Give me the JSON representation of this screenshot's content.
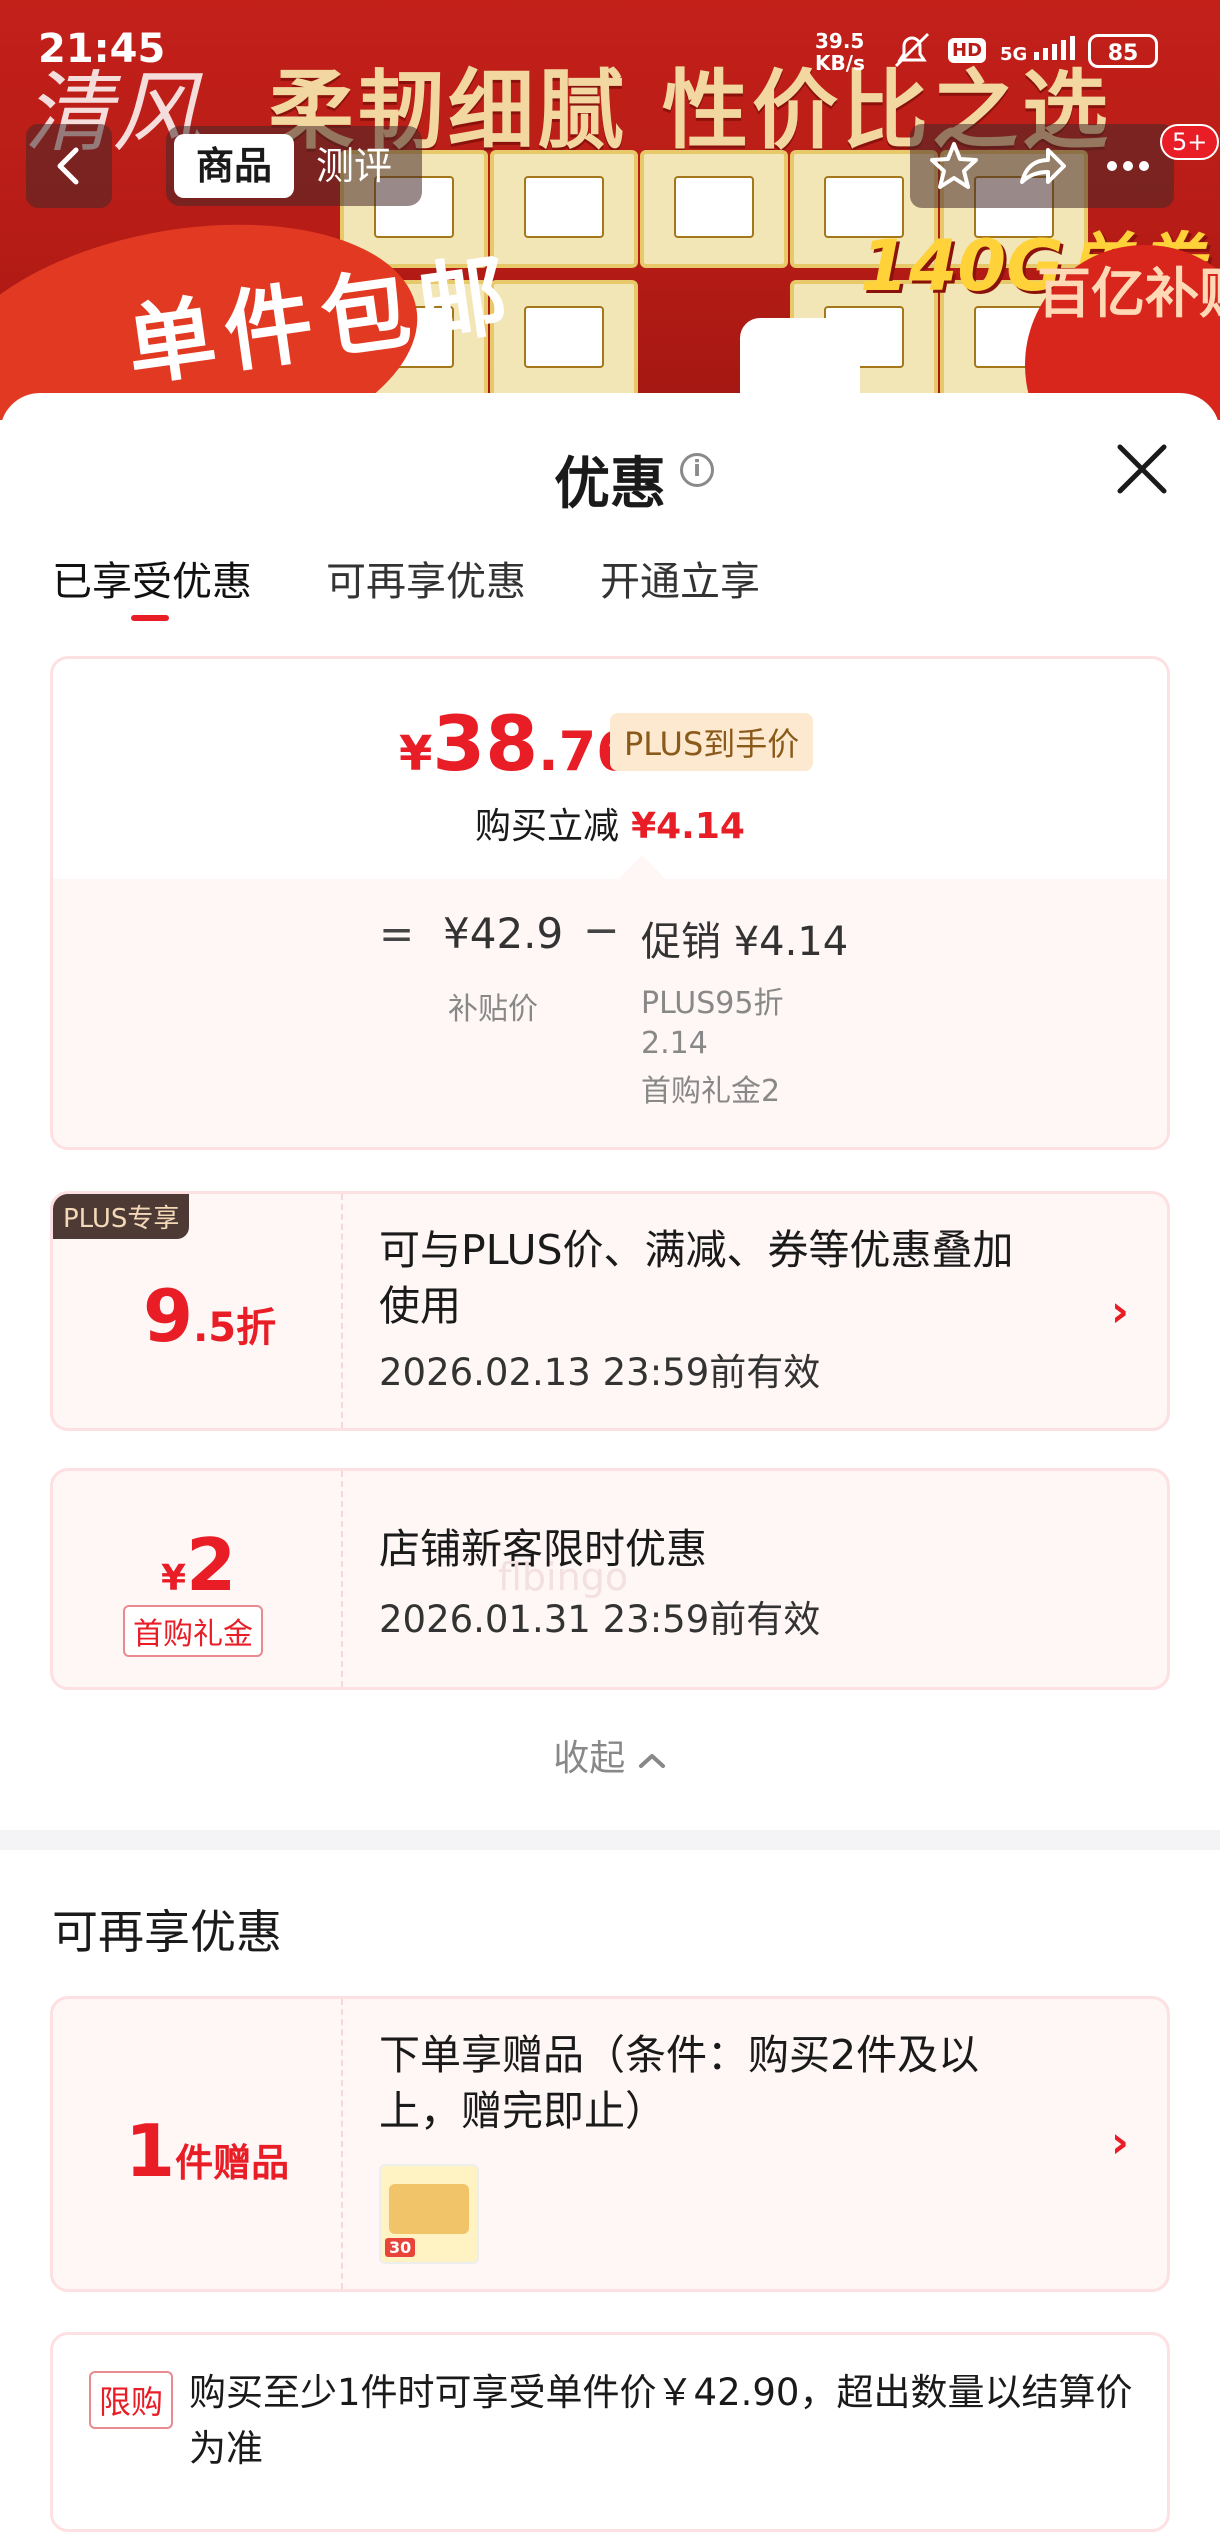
{
  "status_bar": {
    "time": "21:45",
    "net_speed": "39.5",
    "net_unit": "KB/s",
    "hd": "HD",
    "signal": "5G",
    "battery": "85"
  },
  "banner": {
    "slogan": "柔韧细腻 性价比之选",
    "promo_left": "单件包邮",
    "weight": "140G单卷",
    "subsidy": "百亿补贴"
  },
  "nav": {
    "tab_product": "商品",
    "tab_review": "测评",
    "badge": "5+"
  },
  "sheet": {
    "title": "优惠",
    "tabs": [
      "已享受优惠",
      "可再享优惠",
      "开通立享"
    ]
  },
  "price_card": {
    "currency": "¥",
    "price_int": "38",
    "price_dec": ".76",
    "plus_tag": "PLUS到手价",
    "reduce_label": "购买立减",
    "reduce_amount": "¥4.14",
    "eq": "=",
    "subsidy_price": "¥42.9",
    "minus": "−",
    "promo": "促销 ¥4.14",
    "subsidy_label": "补贴价",
    "promo_line1": "PLUS95折",
    "promo_line2": "2.14",
    "promo_line3": "首购礼金2"
  },
  "coupon_plus": {
    "tag": "PLUS专享",
    "discount_big": "9",
    "discount_small": ".5折",
    "desc_line1": "可与PLUS价、满减、券等优惠叠加",
    "desc_line2": "使用",
    "valid": "2026.02.13 23:59前有效"
  },
  "coupon_new": {
    "currency": "¥",
    "amount": "2",
    "tag": "首购礼金",
    "desc": "店铺新客限时优惠",
    "valid": "2026.01.31 23:59前有效"
  },
  "collapse_label": "收起",
  "watermark": "flbingo",
  "more_section": {
    "title": "可再享优惠",
    "gift": {
      "count": "1",
      "unit": "件赠品",
      "desc_line1": "下单享赠品（条件：购买2件及以",
      "desc_line2": "上，赠完即止）"
    },
    "limit": {
      "tag": "限购",
      "text": "购买至少1件时可享受单件价￥42.90，超出数量以结算价为准"
    }
  }
}
